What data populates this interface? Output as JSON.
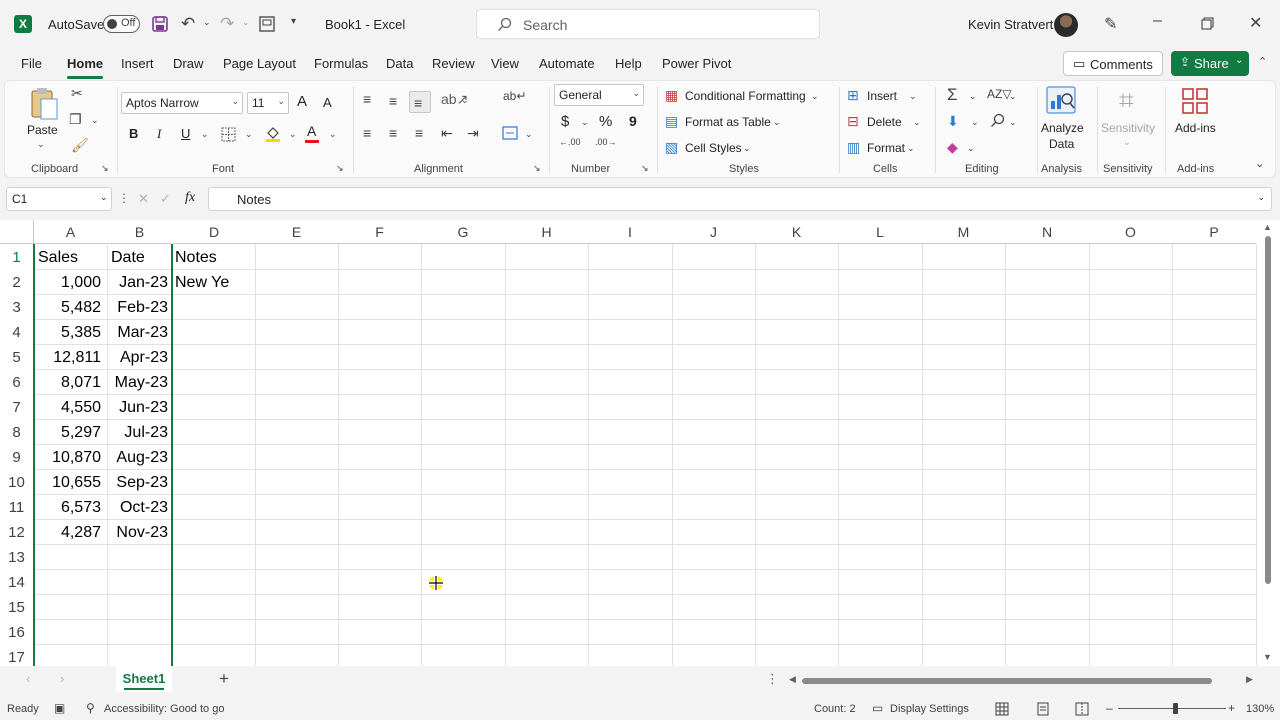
{
  "titlebar": {
    "autosave_label": "AutoSave",
    "autosave_state": "Off",
    "doc_title": "Book1  -  Excel",
    "search_placeholder": "Search",
    "user_name": "Kevin Stratvert"
  },
  "menu": {
    "tabs": [
      "File",
      "Home",
      "Insert",
      "Draw",
      "Page Layout",
      "Formulas",
      "Data",
      "Review",
      "View",
      "Automate",
      "Help",
      "Power Pivot"
    ],
    "comments_label": "Comments",
    "share_label": "Share"
  },
  "ribbon": {
    "clipboard": {
      "paste_label": "Paste",
      "group_label": "Clipboard"
    },
    "font": {
      "font_name": "Aptos Narrow",
      "font_size": "11",
      "group_label": "Font",
      "grow_label": "A",
      "shrink_label": "A",
      "bold": "B",
      "italic": "I",
      "underline": "U",
      "font_color_glyph": "A"
    },
    "alignment": {
      "group_label": "Alignment"
    },
    "number": {
      "format": "General",
      "group_label": "Number",
      "currency": "$",
      "percent": "%",
      "comma": "9"
    },
    "styles": {
      "conditional": "Conditional Formatting",
      "format_table": "Format as Table",
      "cell_styles": "Cell Styles",
      "group_label": "Styles"
    },
    "cells": {
      "insert": "Insert",
      "delete": "Delete",
      "format": "Format",
      "group_label": "Cells"
    },
    "editing": {
      "group_label": "Editing"
    },
    "analysis": {
      "analyze_line1": "Analyze",
      "analyze_line2": "Data",
      "group_label": "Analysis"
    },
    "sensitivity": {
      "label": "Sensitivity",
      "group_label": "Sensitivity"
    },
    "addins": {
      "label": "Add-ins",
      "group_label": "Add-ins"
    }
  },
  "formula_bar": {
    "name_box": "C1",
    "fx": "fx",
    "content": "Notes"
  },
  "grid": {
    "columns": [
      "A",
      "B",
      "D",
      "E",
      "F",
      "G",
      "H",
      "I",
      "J",
      "K",
      "L",
      "M",
      "N",
      "O",
      "P"
    ],
    "rows": [
      "1",
      "2",
      "3",
      "4",
      "5",
      "6",
      "7",
      "8",
      "9",
      "10",
      "11",
      "12",
      "13",
      "14",
      "15",
      "16",
      "17"
    ],
    "headers": {
      "a": "Sales",
      "b": "Date",
      "c": "Notes"
    },
    "c2_text": "New Ye",
    "data": [
      {
        "sales": "1,000",
        "date": "Jan-23"
      },
      {
        "sales": "5,482",
        "date": "Feb-23"
      },
      {
        "sales": "5,385",
        "date": "Mar-23"
      },
      {
        "sales": "12,811",
        "date": "Apr-23"
      },
      {
        "sales": "8,071",
        "date": "May-23"
      },
      {
        "sales": "4,550",
        "date": "Jun-23"
      },
      {
        "sales": "5,297",
        "date": "Jul-23"
      },
      {
        "sales": "10,870",
        "date": "Aug-23"
      },
      {
        "sales": "10,655",
        "date": "Sep-23"
      },
      {
        "sales": "6,573",
        "date": "Oct-23"
      },
      {
        "sales": "4,287",
        "date": "Nov-23"
      }
    ]
  },
  "sheets": {
    "active": "Sheet1",
    "add": "+"
  },
  "status": {
    "ready": "Ready",
    "accessibility": "Accessibility: Good to go",
    "count": "Count: 2",
    "display_settings": "Display Settings",
    "zoom": "130%"
  },
  "colors": {
    "accent": "#107c41"
  }
}
